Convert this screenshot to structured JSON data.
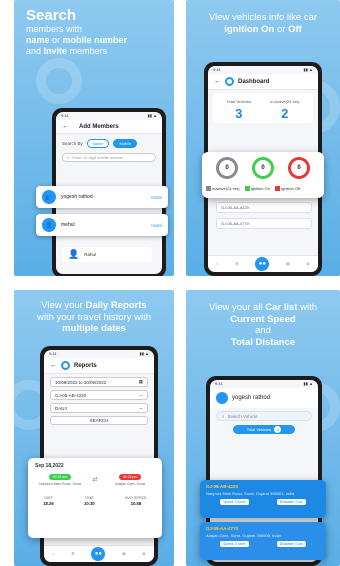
{
  "panel1": {
    "caption_title": "Search",
    "caption_line1": "members with",
    "caption_name": "name",
    "caption_or": "or",
    "caption_mobile": "mobile number",
    "caption_line3_pre": "and",
    "caption_invite": "Invite",
    "caption_line3_post": "members",
    "screen_title": "Add Members",
    "search_by_label": "Search By",
    "pill_name": "Name",
    "pill_mobile": "Mobile",
    "search_placeholder": "Enter 10 digit mobile number",
    "members": [
      {
        "name": "yogesh rathod",
        "action": "Invite"
      },
      {
        "name": "mehul",
        "action": "Invite"
      },
      {
        "name": "Rahul",
        "action": ""
      }
    ]
  },
  "panel2": {
    "caption_line1": "View vehicles info like car",
    "caption_ignition": "ignition",
    "caption_on": "On",
    "caption_or": "or",
    "caption_off": "Off",
    "screen_title": "Dashboard",
    "total_label": "Total Vehicles",
    "total_value": "3",
    "inactive_label": "In-Active(24 hrs)",
    "inactive_value": "2",
    "rings": [
      {
        "value": "0",
        "color": "#8a8a8a"
      },
      {
        "value": "0",
        "color": "#3ecf4a"
      },
      {
        "value": "0",
        "color": "#e53935"
      }
    ],
    "legend": [
      {
        "label": "Inactive(24 hrs)",
        "color": "#8a8a8a"
      },
      {
        "label": "Ignition On",
        "color": "#3ecf4a"
      },
      {
        "label": "Ignition Off",
        "color": "#e53935"
      }
    ],
    "vehicle1": "GJ-05-AA-4220",
    "vehicle2": "GJ-05-AA-4770"
  },
  "panel3": {
    "caption_line1": "View your",
    "caption_daily": "Daily Reports",
    "caption_line2": "with your travel history with",
    "caption_multiple": "multiple dates",
    "screen_title": "Reports",
    "date_range": "10/09/2022 to 30/09/2022",
    "vehicle": "GJ-05-AB-4220",
    "period": "DAILY",
    "search_button": "SEARCH",
    "report_date": "Sep 18,2022",
    "start_time": "09:15 am",
    "end_time": "05:25 pm",
    "start_place": "Nanpura Main Road, Surat",
    "end_place": "Adajan Gam, Surat",
    "cols": [
      {
        "label": "DIST",
        "value": "18.26"
      },
      {
        "label": "TIME",
        "value": "10:30"
      },
      {
        "label": "AVG.SPEED",
        "value": "10.58"
      }
    ]
  },
  "panel4": {
    "caption_line1": "View your all",
    "caption_car_list": "Car list",
    "caption_with": "with",
    "caption_speed": "Current Speed",
    "caption_and": "and",
    "caption_distance": "Total Distance",
    "user_name": "yogesh rathod",
    "search_placeholder": "Search Vehicle",
    "total_label": "Total Vehicles",
    "total_value": "3",
    "vehicles": [
      {
        "plate": "GJ-05-AB-4220",
        "address": "Nanpura Main Road, Surat, Gujarat 395001, India",
        "speed": "Speed: 0 km/h",
        "dist": "Distance: 0 km"
      },
      {
        "plate": "GJ-05-AA-4770",
        "address": "Adajan Gam, Surat, Gujarat 395009, India",
        "speed": "Speed: 0 km/h",
        "dist": "Distance: 0 km"
      }
    ]
  }
}
